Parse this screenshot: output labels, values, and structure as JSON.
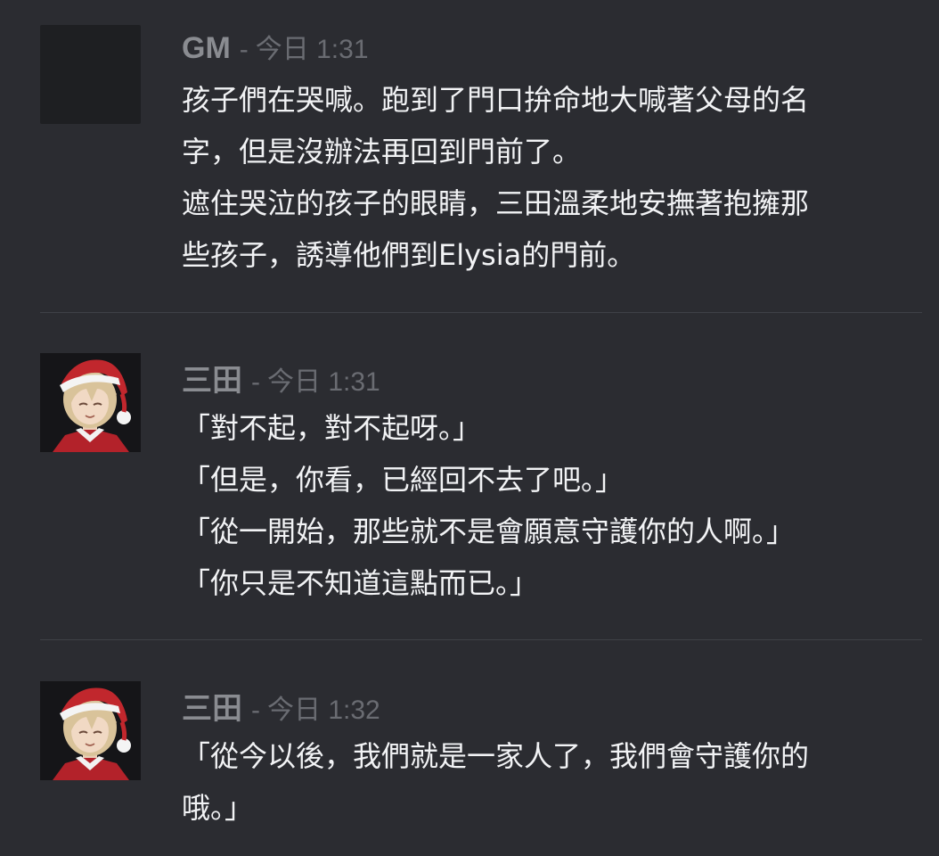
{
  "messages": [
    {
      "username": "GM",
      "separator": "-",
      "timestamp": "今日 1:31",
      "avatar": "blank-avatar",
      "lines": [
        "孩子們在哭喊。跑到了門口拚命地大喊著父母的名",
        "字，但是沒辦法再回到門前了。",
        "遮住哭泣的孩子的眼睛，三田溫柔地安撫著抱擁那",
        "些孩子，誘導他們到Elysia的門前。"
      ]
    },
    {
      "username": "三田",
      "separator": "-",
      "timestamp": "今日 1:31",
      "avatar": "santa-hat-character-avatar",
      "lines": [
        "「對不起，對不起呀。」",
        "「但是，你看，已經回不去了吧。」",
        "「從一開始，那些就不是會願意守護你的人啊。」",
        "「你只是不知道這點而已。」"
      ]
    },
    {
      "username": "三田",
      "separator": "-",
      "timestamp": "今日 1:32",
      "avatar": "santa-hat-character-avatar",
      "lines": [
        "「從今以後，我們就是一家人了，我們會守護你的",
        "哦。」"
      ]
    }
  ]
}
